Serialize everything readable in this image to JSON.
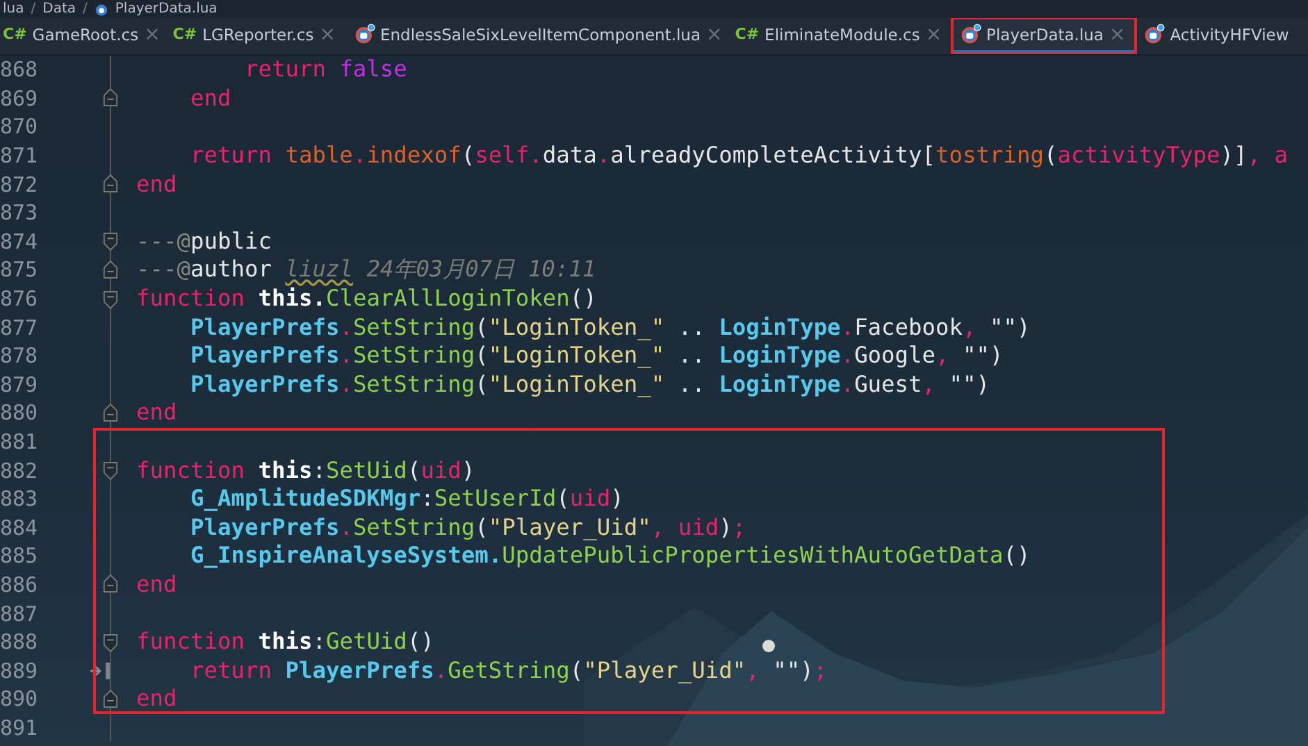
{
  "breadcrumb": {
    "separator": "/",
    "items": [
      {
        "label": "lua",
        "kind": "folder"
      },
      {
        "label": "Data",
        "kind": "folder"
      },
      {
        "label": "PlayerData.lua",
        "kind": "lua"
      }
    ]
  },
  "tabs": [
    {
      "label": "GameRoot.cs",
      "kind": "csharp",
      "badge": "C#",
      "close": "×",
      "selected": false,
      "annotated": false
    },
    {
      "label": "LGReporter.cs",
      "kind": "csharp",
      "badge": "C#",
      "close": "×",
      "selected": false,
      "annotated": false
    },
    {
      "label": "EndlessSaleSixLevelItemComponent.lua",
      "kind": "lua",
      "close": "×",
      "selected": false,
      "annotated": false
    },
    {
      "label": "EliminateModule.cs",
      "kind": "csharp",
      "badge": "C#",
      "close": "×",
      "selected": false,
      "annotated": false
    },
    {
      "label": "PlayerData.lua",
      "kind": "lua",
      "close": "×",
      "selected": true,
      "annotated": true
    },
    {
      "label": "ActivityHFView",
      "kind": "lua",
      "selected": false,
      "annotated": false
    }
  ],
  "blocks": [
    {
      "annotated": false,
      "lines": [
        {
          "number": "868",
          "tokens": [
            {
              "kind": "keyword",
              "text": "        return "
            },
            {
              "kind": "bool",
              "text": "false"
            }
          ]
        },
        {
          "number": "869",
          "fold_end": true,
          "tokens": [
            {
              "kind": "keyword",
              "text": "    end"
            }
          ]
        },
        {
          "number": "870"
        },
        {
          "number": "871",
          "tokens": [
            {
              "kind": "keyword",
              "text": "    return "
            },
            {
              "kind": "builtin",
              "text": "table"
            },
            {
              "kind": "punct",
              "text": "."
            },
            {
              "kind": "builtin",
              "text": "indexof"
            },
            {
              "kind": "plain",
              "text": "("
            },
            {
              "kind": "self",
              "text": "self"
            },
            {
              "kind": "punct",
              "text": "."
            },
            {
              "kind": "plain",
              "text": "data"
            },
            {
              "kind": "punct",
              "text": "."
            },
            {
              "kind": "plain",
              "text": "alreadyCompleteActivity["
            },
            {
              "kind": "builtin",
              "text": "tostring"
            },
            {
              "kind": "plain",
              "text": "("
            },
            {
              "kind": "param",
              "text": "activityType"
            },
            {
              "kind": "plain",
              "text": ")]"
            },
            {
              "kind": "punct",
              "text": ", "
            },
            {
              "kind": "param",
              "text": "a"
            }
          ]
        },
        {
          "number": "872",
          "fold_end": true,
          "tokens": [
            {
              "kind": "keyword",
              "text": "end"
            }
          ]
        },
        {
          "number": "873"
        },
        {
          "number": "874",
          "fold_start": true,
          "tokens": [
            {
              "kind": "comment",
              "text": "---@"
            },
            {
              "kind": "plain",
              "text": "public"
            }
          ]
        },
        {
          "number": "875",
          "fold_end": true,
          "tokens": [
            {
              "kind": "comment",
              "text": "---@"
            },
            {
              "kind": "plain",
              "text": "author "
            },
            {
              "kind": "user",
              "text": "liuzl"
            },
            {
              "kind": "hint",
              "text": " 24年03月07日 10:11"
            }
          ]
        },
        {
          "number": "876",
          "fold_start": true,
          "tokens": [
            {
              "kind": "keyword",
              "text": "function "
            },
            {
              "kind": "this",
              "text": "this."
            },
            {
              "kind": "method",
              "text": "ClearAllLoginToken"
            },
            {
              "kind": "plain",
              "text": "()"
            }
          ]
        },
        {
          "number": "877",
          "tokens": [
            {
              "kind": "class",
              "text": "    PlayerPrefs"
            },
            {
              "kind": "punct",
              "text": "."
            },
            {
              "kind": "method",
              "text": "SetString"
            },
            {
              "kind": "plain",
              "text": "("
            },
            {
              "kind": "string",
              "text": "\"LoginToken_\""
            },
            {
              "kind": "plain",
              "text": " .. "
            },
            {
              "kind": "class",
              "text": "LoginType"
            },
            {
              "kind": "punct",
              "text": "."
            },
            {
              "kind": "plain",
              "text": "Facebook"
            },
            {
              "kind": "punct",
              "text": ", "
            },
            {
              "kind": "plain",
              "text": "\"\")"
            }
          ]
        },
        {
          "number": "878",
          "tokens": [
            {
              "kind": "class",
              "text": "    PlayerPrefs"
            },
            {
              "kind": "punct",
              "text": "."
            },
            {
              "kind": "method",
              "text": "SetString"
            },
            {
              "kind": "plain",
              "text": "("
            },
            {
              "kind": "string",
              "text": "\"LoginToken_\""
            },
            {
              "kind": "plain",
              "text": " .. "
            },
            {
              "kind": "class",
              "text": "LoginType"
            },
            {
              "kind": "punct",
              "text": "."
            },
            {
              "kind": "plain",
              "text": "Google"
            },
            {
              "kind": "punct",
              "text": ", "
            },
            {
              "kind": "plain",
              "text": "\"\")"
            }
          ]
        },
        {
          "number": "879",
          "tokens": [
            {
              "kind": "class",
              "text": "    PlayerPrefs"
            },
            {
              "kind": "punct",
              "text": "."
            },
            {
              "kind": "method",
              "text": "SetString"
            },
            {
              "kind": "plain",
              "text": "("
            },
            {
              "kind": "string",
              "text": "\"LoginToken_\""
            },
            {
              "kind": "plain",
              "text": " .. "
            },
            {
              "kind": "class",
              "text": "LoginType"
            },
            {
              "kind": "punct",
              "text": "."
            },
            {
              "kind": "plain",
              "text": "Guest"
            },
            {
              "kind": "punct",
              "text": ", "
            },
            {
              "kind": "plain",
              "text": "\"\")"
            }
          ]
        },
        {
          "number": "880",
          "fold_end": true,
          "tokens": [
            {
              "kind": "keyword",
              "text": "end"
            }
          ]
        }
      ]
    },
    {
      "annotated": true,
      "lines": [
        {
          "number": "881"
        },
        {
          "number": "882",
          "fold_start": true,
          "tokens": [
            {
              "kind": "keyword",
              "text": "function "
            },
            {
              "kind": "this",
              "text": "this"
            },
            {
              "kind": "plain",
              "text": ":"
            },
            {
              "kind": "method",
              "text": "SetUid"
            },
            {
              "kind": "plain",
              "text": "("
            },
            {
              "kind": "param",
              "text": "uid"
            },
            {
              "kind": "plain",
              "text": ")"
            }
          ]
        },
        {
          "number": "883",
          "tokens": [
            {
              "kind": "class",
              "text": "    G_AmplitudeSDKMgr"
            },
            {
              "kind": "plain",
              "text": ":"
            },
            {
              "kind": "method",
              "text": "SetUserId"
            },
            {
              "kind": "plain",
              "text": "("
            },
            {
              "kind": "param",
              "text": "uid"
            },
            {
              "kind": "plain",
              "text": ")"
            }
          ]
        },
        {
          "number": "884",
          "tokens": [
            {
              "kind": "class",
              "text": "    PlayerPrefs"
            },
            {
              "kind": "punct",
              "text": "."
            },
            {
              "kind": "method",
              "text": "SetString"
            },
            {
              "kind": "plain",
              "text": "("
            },
            {
              "kind": "string",
              "text": "\"Player_Uid\""
            },
            {
              "kind": "punct",
              "text": ", "
            },
            {
              "kind": "param",
              "text": "uid"
            },
            {
              "kind": "plain",
              "text": ")"
            },
            {
              "kind": "punct",
              "text": ";"
            }
          ]
        },
        {
          "number": "885",
          "tokens": [
            {
              "kind": "class",
              "text": "    G_InspireAnalyseSystem."
            },
            {
              "kind": "method",
              "text": "UpdatePublicPropertiesWithAutoGetData"
            },
            {
              "kind": "plain",
              "text": "()"
            }
          ]
        },
        {
          "number": "886",
          "fold_end": true,
          "tokens": [
            {
              "kind": "keyword",
              "text": "end"
            }
          ]
        },
        {
          "number": "887"
        },
        {
          "number": "888",
          "fold_start": true,
          "tokens": [
            {
              "kind": "keyword",
              "text": "function "
            },
            {
              "kind": "this",
              "text": "this"
            },
            {
              "kind": "plain",
              "text": ":"
            },
            {
              "kind": "method",
              "text": "GetUid"
            },
            {
              "kind": "plain",
              "text": "()"
            }
          ]
        },
        {
          "number": "889",
          "tab_marker": true,
          "tokens": [
            {
              "kind": "keyword",
              "text": "    return "
            },
            {
              "kind": "class",
              "text": "PlayerPrefs"
            },
            {
              "kind": "punct",
              "text": "."
            },
            {
              "kind": "method",
              "text": "GetString"
            },
            {
              "kind": "plain",
              "text": "("
            },
            {
              "kind": "string",
              "text": "\"Player_Uid\""
            },
            {
              "kind": "punct",
              "text": ", "
            },
            {
              "kind": "plain",
              "text": "\"\")"
            },
            {
              "kind": "punct",
              "text": ";"
            }
          ]
        },
        {
          "number": "890",
          "fold_end": true,
          "tokens": [
            {
              "kind": "keyword",
              "text": "end"
            }
          ]
        }
      ]
    },
    {
      "annotated": false,
      "lines": [
        {
          "number": "891"
        }
      ]
    }
  ]
}
